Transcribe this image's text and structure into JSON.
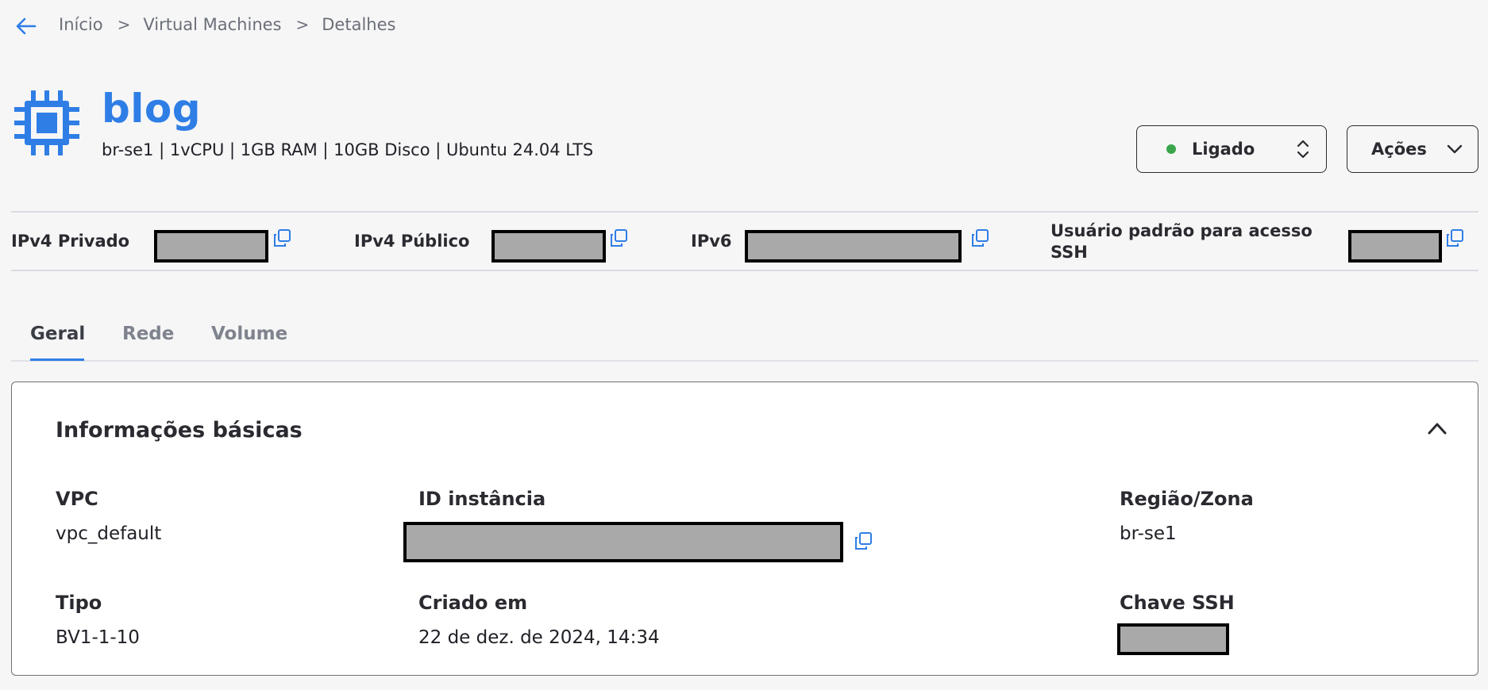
{
  "breadcrumb": {
    "items": [
      "Início",
      "Virtual Machines",
      "Detalhes"
    ],
    "separator": ">"
  },
  "header": {
    "title": "blog",
    "specs": "br-se1 | 1vCPU | 1GB RAM | 10GB Disco | Ubuntu 24.04 LTS",
    "icon": "chip-icon",
    "accent_color": "#2f7ee6"
  },
  "status": {
    "label": "Ligado",
    "dot_color": "#3aa64b"
  },
  "actions": {
    "label": "Ações"
  },
  "ip_info": {
    "private_label": "IPv4 Privado",
    "public_label": "IPv4 Público",
    "ipv6_label": "IPv6",
    "ssh_user_label_line1": "Usuário padrão para acesso",
    "ssh_user_label_line2": "SSH"
  },
  "tabs": [
    {
      "label": "Geral",
      "active": true
    },
    {
      "label": "Rede",
      "active": false
    },
    {
      "label": "Volume",
      "active": false
    }
  ],
  "basic_info": {
    "title": "Informações básicas",
    "vpc_label": "VPC",
    "vpc_value": "vpc_default",
    "instance_id_label": "ID instância",
    "region_label": "Região/Zona",
    "region_value": "br-se1",
    "type_label": "Tipo",
    "type_value": "BV1-1-10",
    "created_label": "Criado em",
    "created_value": "22 de dez. de 2024, 14:34",
    "ssh_key_label": "Chave SSH"
  }
}
